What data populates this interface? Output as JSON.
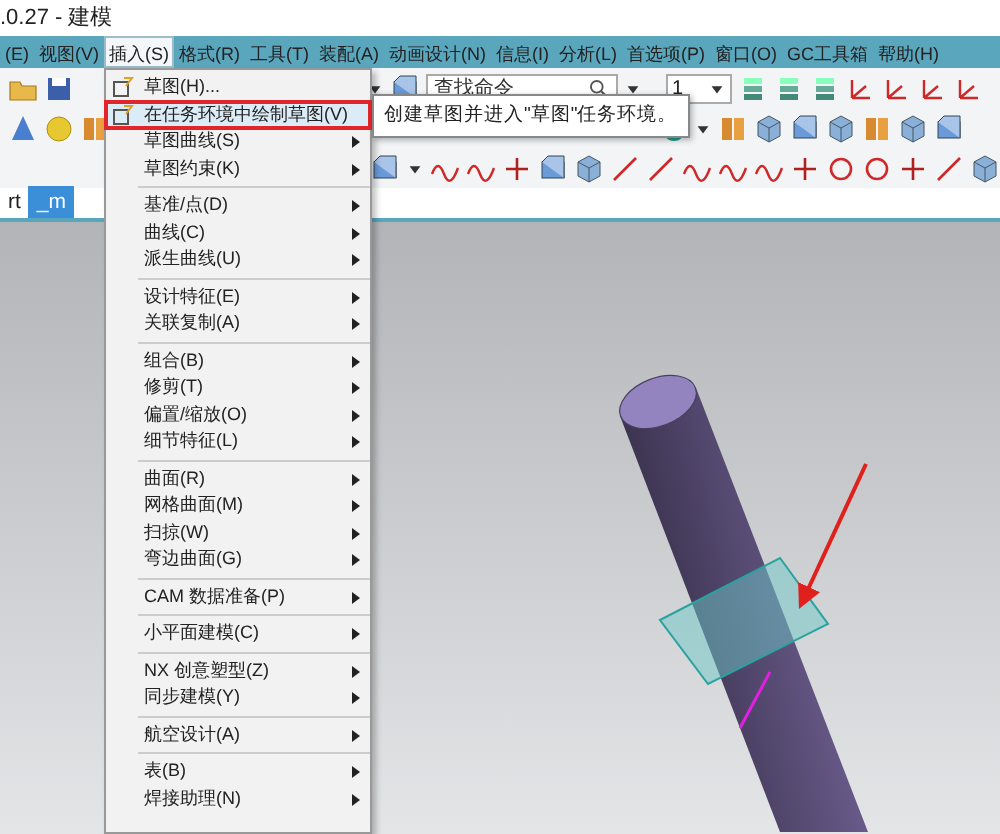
{
  "window": {
    "title": ".0.27 - 建模"
  },
  "menu_bar": [
    {
      "label": "(E)",
      "selected": false
    },
    {
      "label": "视图(V)",
      "selected": false
    },
    {
      "label": "插入(S)",
      "selected": true
    },
    {
      "label": "格式(R)",
      "selected": false
    },
    {
      "label": "工具(T)",
      "selected": false
    },
    {
      "label": "装配(A)",
      "selected": false
    },
    {
      "label": "动画设计(N)",
      "selected": false
    },
    {
      "label": "信息(I)",
      "selected": false
    },
    {
      "label": "分析(L)",
      "selected": false
    },
    {
      "label": "首选项(P)",
      "selected": false
    },
    {
      "label": "窗口(O)",
      "selected": false
    },
    {
      "label": "GC工具箱",
      "selected": false
    },
    {
      "label": "帮助(H)",
      "selected": false
    }
  ],
  "toolbar": {
    "search": {
      "placeholder": "查找命令"
    },
    "layer_dropdown": {
      "value": "1"
    }
  },
  "tabs": [
    {
      "label": "rt",
      "selected": false
    },
    {
      "label": "_m",
      "selected": true
    }
  ],
  "insert_menu": {
    "items": [
      {
        "kind": "item",
        "label": "草图(H)...",
        "icon": true,
        "submenu": false,
        "selected": false,
        "outlined": false
      },
      {
        "kind": "item",
        "label": "在任务环境中绘制草图(V)",
        "icon": true,
        "submenu": false,
        "selected": true,
        "outlined": true
      },
      {
        "kind": "item",
        "label": "草图曲线(S)",
        "icon": false,
        "submenu": true,
        "selected": false,
        "outlined": false
      },
      {
        "kind": "item",
        "label": "草图约束(K)",
        "icon": false,
        "submenu": true,
        "selected": false,
        "outlined": false
      },
      {
        "kind": "separator"
      },
      {
        "kind": "item",
        "label": "基准/点(D)",
        "icon": false,
        "submenu": true,
        "selected": false,
        "outlined": false
      },
      {
        "kind": "item",
        "label": "曲线(C)",
        "icon": false,
        "submenu": true,
        "selected": false,
        "outlined": false
      },
      {
        "kind": "item",
        "label": "派生曲线(U)",
        "icon": false,
        "submenu": true,
        "selected": false,
        "outlined": false
      },
      {
        "kind": "separator"
      },
      {
        "kind": "item",
        "label": "设计特征(E)",
        "icon": false,
        "submenu": true,
        "selected": false,
        "outlined": false
      },
      {
        "kind": "item",
        "label": "关联复制(A)",
        "icon": false,
        "submenu": true,
        "selected": false,
        "outlined": false
      },
      {
        "kind": "separator"
      },
      {
        "kind": "item",
        "label": "组合(B)",
        "icon": false,
        "submenu": true,
        "selected": false,
        "outlined": false
      },
      {
        "kind": "item",
        "label": "修剪(T)",
        "icon": false,
        "submenu": true,
        "selected": false,
        "outlined": false
      },
      {
        "kind": "item",
        "label": "偏置/缩放(O)",
        "icon": false,
        "submenu": true,
        "selected": false,
        "outlined": false
      },
      {
        "kind": "item",
        "label": "细节特征(L)",
        "icon": false,
        "submenu": true,
        "selected": false,
        "outlined": false
      },
      {
        "kind": "separator"
      },
      {
        "kind": "item",
        "label": "曲面(R)",
        "icon": false,
        "submenu": true,
        "selected": false,
        "outlined": false
      },
      {
        "kind": "item",
        "label": "网格曲面(M)",
        "icon": false,
        "submenu": true,
        "selected": false,
        "outlined": false
      },
      {
        "kind": "item",
        "label": "扫掠(W)",
        "icon": false,
        "submenu": true,
        "selected": false,
        "outlined": false
      },
      {
        "kind": "item",
        "label": "弯边曲面(G)",
        "icon": false,
        "submenu": true,
        "selected": false,
        "outlined": false
      },
      {
        "kind": "separator"
      },
      {
        "kind": "item",
        "label": "CAM 数据准备(P)",
        "icon": false,
        "submenu": true,
        "selected": false,
        "outlined": false
      },
      {
        "kind": "separator"
      },
      {
        "kind": "item",
        "label": "小平面建模(C)",
        "icon": false,
        "submenu": true,
        "selected": false,
        "outlined": false
      },
      {
        "kind": "separator"
      },
      {
        "kind": "item",
        "label": "NX 创意塑型(Z)",
        "icon": false,
        "submenu": true,
        "selected": false,
        "outlined": false
      },
      {
        "kind": "item",
        "label": "同步建模(Y)",
        "icon": false,
        "submenu": true,
        "selected": false,
        "outlined": false
      },
      {
        "kind": "separator"
      },
      {
        "kind": "item",
        "label": "航空设计(A)",
        "icon": false,
        "submenu": true,
        "selected": false,
        "outlined": false
      },
      {
        "kind": "separator"
      },
      {
        "kind": "item",
        "label": "表(B)",
        "icon": false,
        "submenu": true,
        "selected": false,
        "outlined": false
      },
      {
        "kind": "item",
        "label": "焊接助理(N)",
        "icon": false,
        "submenu": true,
        "selected": false,
        "outlined": false
      }
    ]
  },
  "tooltip": {
    "text": "创建草图并进入\"草图\"任务环境。"
  }
}
